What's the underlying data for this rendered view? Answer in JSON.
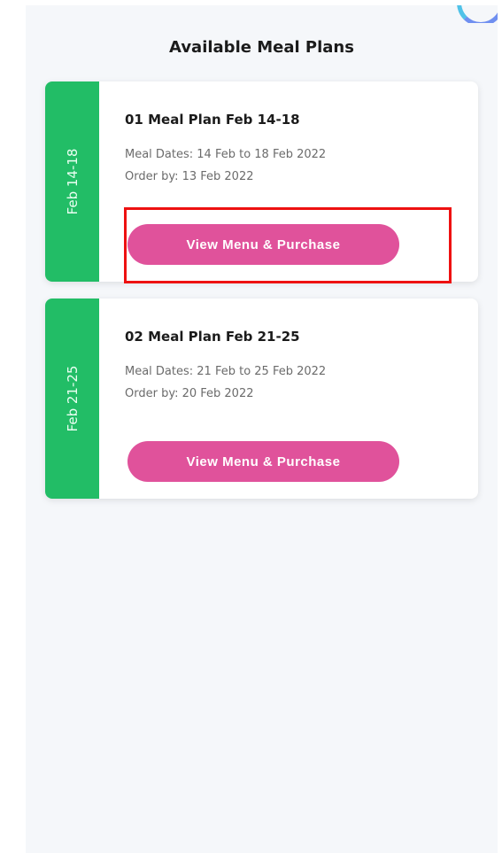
{
  "page_title": "Available Meal Plans",
  "plans": [
    {
      "tab_label": "Feb 14-18",
      "title": "01 Meal Plan Feb 14-18",
      "meal_dates": "Meal Dates: 14 Feb to 18 Feb 2022",
      "order_by": "Order by: 13 Feb 2022",
      "button_label": "View Menu & Purchase"
    },
    {
      "tab_label": "Feb 21-25",
      "title": "02 Meal Plan Feb 21-25",
      "meal_dates": "Meal Dates: 21 Feb to 25 Feb 2022",
      "order_by": "Order by: 20 Feb 2022",
      "button_label": "View Menu & Purchase"
    }
  ],
  "colors": {
    "tab_green": "#22bd66",
    "button_pink": "#e0529b",
    "highlight_red": "#ee1111",
    "background": "#f5f7fa"
  }
}
